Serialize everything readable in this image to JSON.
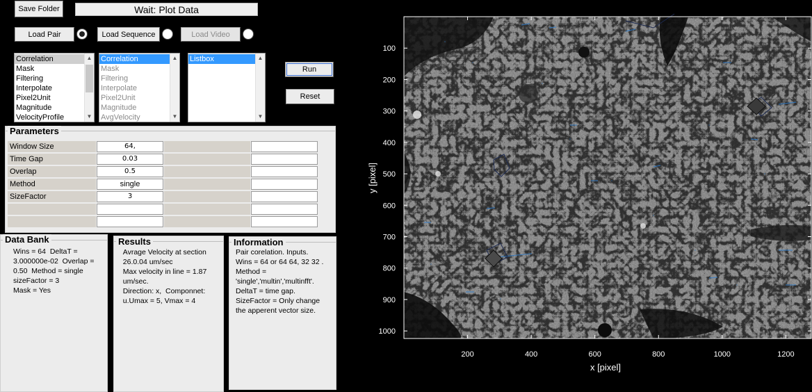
{
  "toolbar": {
    "save_folder": "Save Folder",
    "status": "Wait:  Plot Data",
    "load_pair": "Load Pair",
    "load_sequence": "Load Sequence",
    "load_video": "Load Video",
    "run": "Run",
    "reset": "Reset"
  },
  "list1": {
    "items": [
      "Correlation",
      "Mask",
      "Filtering",
      "Interpolate",
      "Pixel2Unit",
      "Magnitude",
      "VelocityProfile"
    ]
  },
  "list2": {
    "items": [
      "Correlation",
      "Mask",
      "Filtering",
      "Interpolate",
      "Pixel2Unit",
      "Magnitude",
      "AvgVelocity"
    ]
  },
  "list3": {
    "items": [
      "Listbox"
    ]
  },
  "parameters": {
    "title": "Parameters",
    "rows": [
      {
        "label": "Window Size",
        "value": "64,"
      },
      {
        "label": "Time Gap",
        "value": "0.03"
      },
      {
        "label": "Overlap",
        "value": "0.5"
      },
      {
        "label": "Method",
        "value": "single"
      },
      {
        "label": "SizeFactor",
        "value": "3"
      },
      {
        "label": "",
        "value": ""
      },
      {
        "label": "",
        "value": ""
      }
    ]
  },
  "databank": {
    "title": "Data Bank",
    "text": "Wins = 64  DeltaT =\n3.000000e-02  Overlap =\n0.50  Method = single\nsizeFactor = 3\nMask = Yes"
  },
  "results": {
    "title": "Results",
    "text": "   Avrage Velocity at section\n   26.0.04 um/sec\n   Max velocity in line = 1.87\n   um/sec.\n   Direction: x,  Componnet:\n   u.Umax = 5, Vmax = 4"
  },
  "information": {
    "title": "Information",
    "text": "Pair corelation. Inputs.\nWins = 64 or 64 64, 32 32 .\nMethod =\n'single','multin','multinfft'.\nDeltaT = time gap.\nSizeFactor = Only change\nthe apperent vector size."
  },
  "plot": {
    "xlabel": "x [pixel]",
    "ylabel": "y [pixel]",
    "xticks": [
      "200",
      "400",
      "600",
      "800",
      "1000",
      "1200"
    ],
    "yticks": [
      "100",
      "200",
      "300",
      "400",
      "500",
      "600",
      "700",
      "800",
      "900",
      "1000"
    ],
    "xlim": [
      0,
      1280
    ],
    "ylim": [
      0,
      1024
    ],
    "colors": {
      "background": "#000000",
      "axis": "#ffffff",
      "vectors": "#2f7fd0"
    }
  }
}
